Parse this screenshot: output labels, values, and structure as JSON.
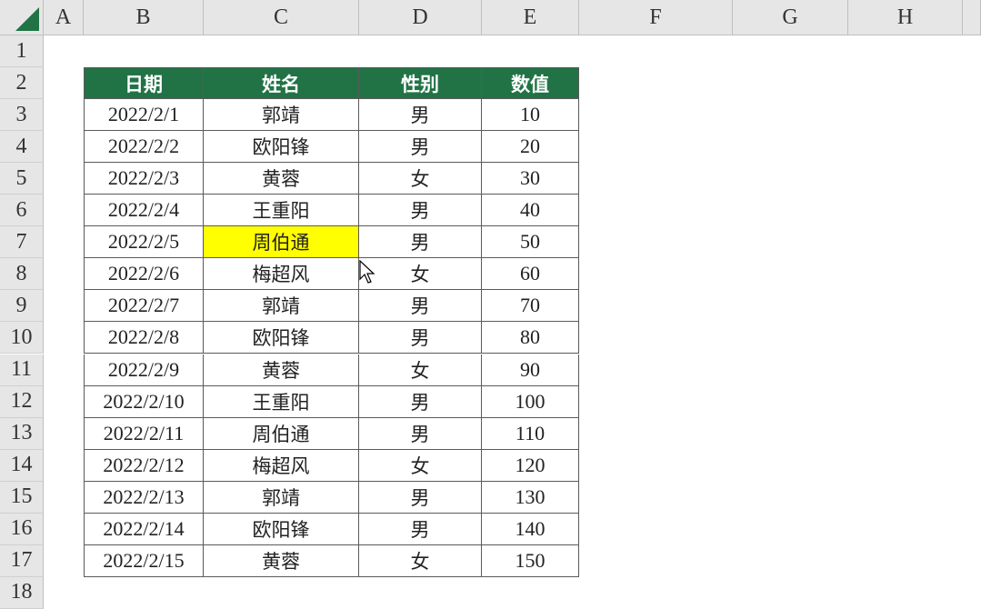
{
  "column_headers": [
    "A",
    "B",
    "C",
    "D",
    "E",
    "F",
    "G",
    "H"
  ],
  "row_headers": [
    "1",
    "2",
    "3",
    "4",
    "5",
    "6",
    "7",
    "8",
    "9",
    "10",
    "11",
    "12",
    "13",
    "14",
    "15",
    "16",
    "17",
    "18"
  ],
  "table": {
    "headers": [
      "日期",
      "姓名",
      "性别",
      "数值"
    ],
    "rows": [
      [
        "2022/2/1",
        "郭靖",
        "男",
        "10"
      ],
      [
        "2022/2/2",
        "欧阳锋",
        "男",
        "20"
      ],
      [
        "2022/2/3",
        "黄蓉",
        "女",
        "30"
      ],
      [
        "2022/2/4",
        "王重阳",
        "男",
        "40"
      ],
      [
        "2022/2/5",
        "周伯通",
        "男",
        "50"
      ],
      [
        "2022/2/6",
        "梅超风",
        "女",
        "60"
      ],
      [
        "2022/2/7",
        "郭靖",
        "男",
        "70"
      ],
      [
        "2022/2/8",
        "欧阳锋",
        "男",
        "80"
      ],
      [
        "2022/2/9",
        "黄蓉",
        "女",
        "90"
      ],
      [
        "2022/2/10",
        "王重阳",
        "男",
        "100"
      ],
      [
        "2022/2/11",
        "周伯通",
        "男",
        "110"
      ],
      [
        "2022/2/12",
        "梅超风",
        "女",
        "120"
      ],
      [
        "2022/2/13",
        "郭靖",
        "男",
        "130"
      ],
      [
        "2022/2/14",
        "欧阳锋",
        "男",
        "140"
      ],
      [
        "2022/2/15",
        "黄蓉",
        "女",
        "150"
      ]
    ],
    "highlighted_cell": {
      "row": 4,
      "col": 1,
      "color": "#ffff00"
    }
  },
  "colors": {
    "header_bg": "#217346",
    "header_text": "#ffffff",
    "highlight": "#ffff00"
  }
}
